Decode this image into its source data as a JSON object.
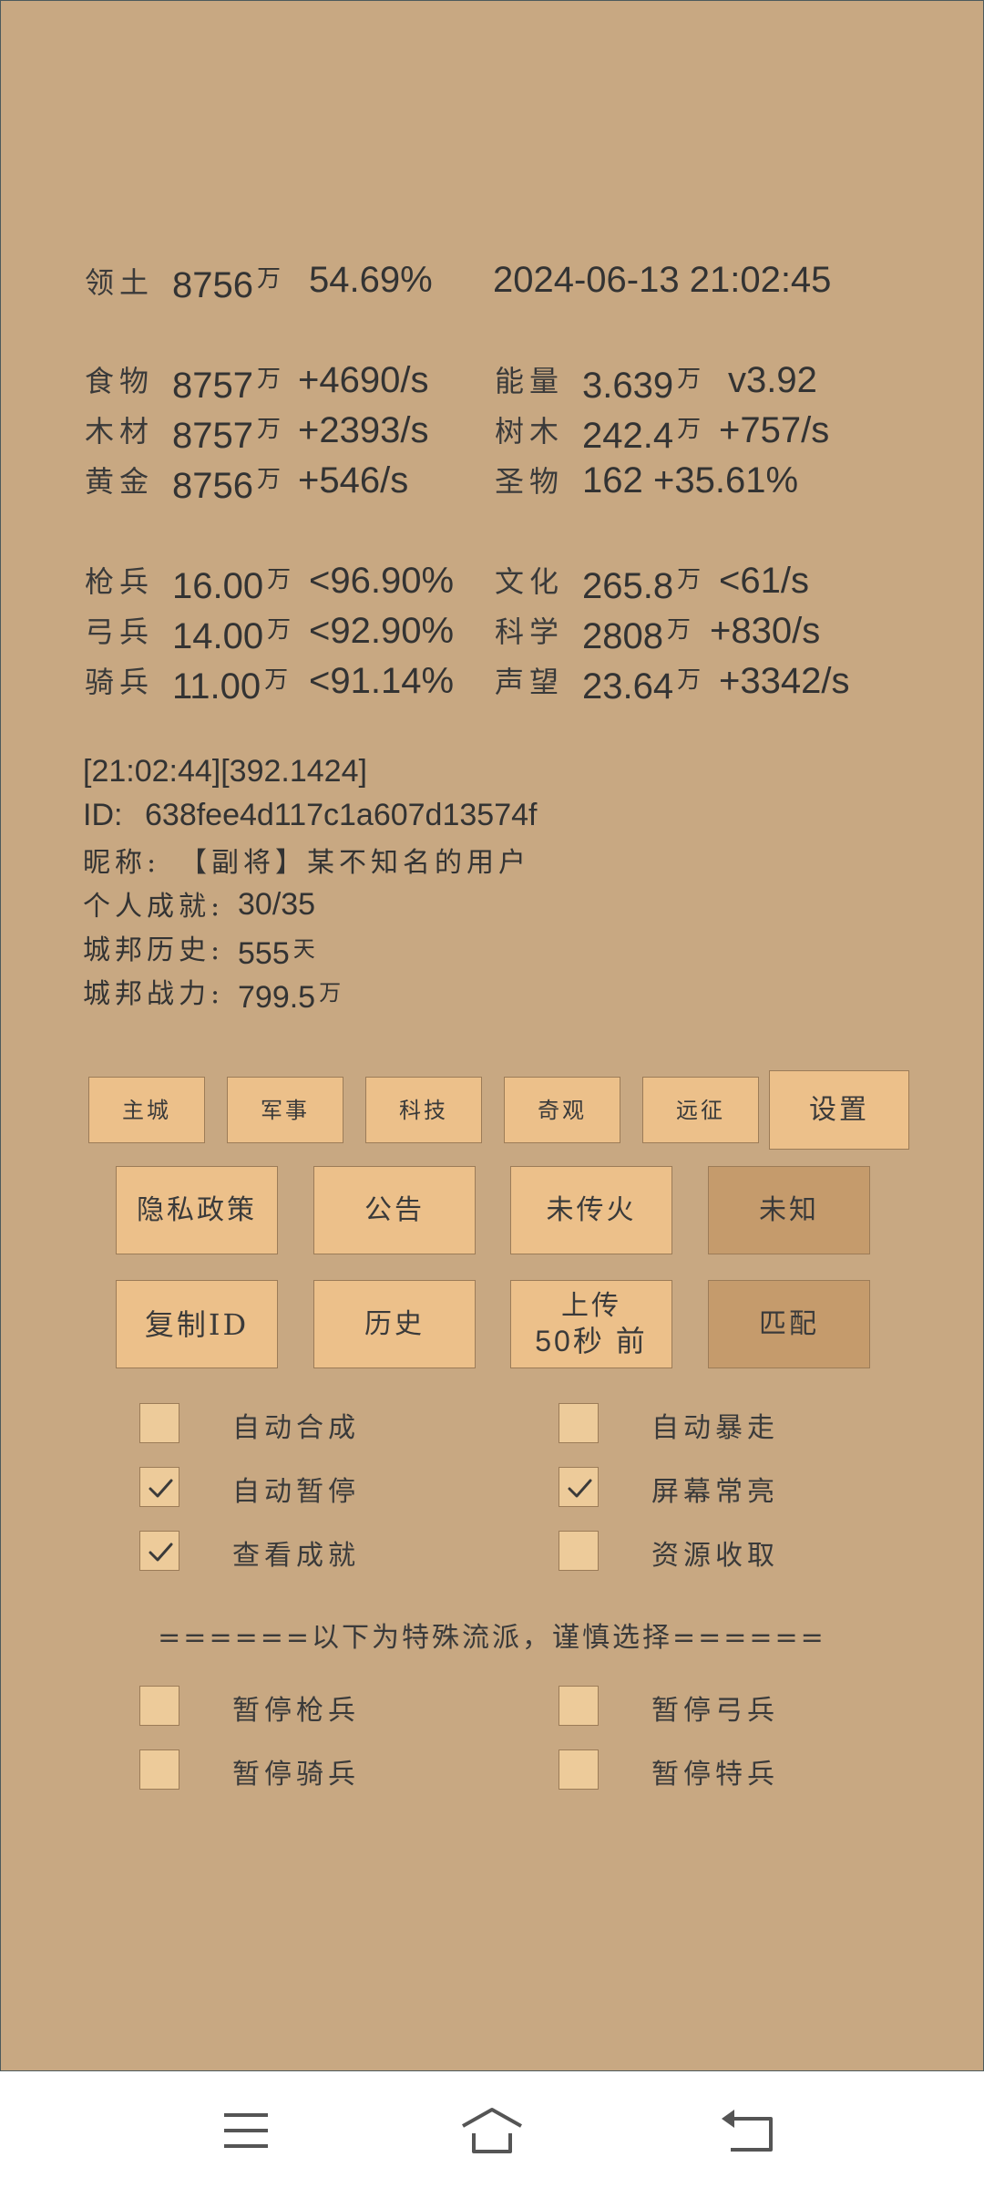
{
  "header": {
    "territory_label": "领土",
    "territory_value": "8756",
    "territory_unit": "万",
    "territory_pct": "54.69%",
    "datetime": "2024-06-13 21:02:45"
  },
  "resources": {
    "food_label": "食物",
    "food_value": "8757",
    "food_unit": "万",
    "food_rate": "+4690/s",
    "wood_label": "木材",
    "wood_value": "8757",
    "wood_unit": "万",
    "wood_rate": "+2393/s",
    "gold_label": "黄金",
    "gold_value": "8756",
    "gold_unit": "万",
    "gold_rate": "+546/s",
    "energy_label": "能量",
    "energy_value": "3.639",
    "energy_unit": "万",
    "energy_extra": "v3.92",
    "tree_label": "树木",
    "tree_value": "242.4",
    "tree_unit": "万",
    "tree_rate": "+757/s",
    "relic_label": "圣物",
    "relic_value": "162",
    "relic_rate": "+35.61%"
  },
  "troops": {
    "spear_label": "枪兵",
    "spear_value": "16.00",
    "spear_unit": "万",
    "spear_rate": "<96.90%",
    "archer_label": "弓兵",
    "archer_value": "14.00",
    "archer_unit": "万",
    "archer_rate": "<92.90%",
    "cavalry_label": "骑兵",
    "cavalry_value": "11.00",
    "cavalry_unit": "万",
    "cavalry_rate": "<91.14%",
    "culture_label": "文化",
    "culture_value": "265.8",
    "culture_unit": "万",
    "culture_rate": "<61/s",
    "science_label": "科学",
    "science_value": "2808",
    "science_unit": "万",
    "science_rate": "+830/s",
    "fame_label": "声望",
    "fame_value": "23.64",
    "fame_unit": "万",
    "fame_rate": "+3342/s"
  },
  "info": {
    "log": "[21:02:44][392.1424]",
    "id_label": "ID:",
    "id_value": "638fee4d117c1a607d13574f",
    "nick_label": "昵称:",
    "nick_value": "【副将】某不知名的用户",
    "achieve_label": "个人成就:",
    "achieve_value": "30/35",
    "history_label": "城邦历史:",
    "history_value": "555",
    "history_unit": "天",
    "power_label": "城邦战力:",
    "power_value": "799.5",
    "power_unit": "万"
  },
  "tabs": {
    "main_city": "主城",
    "military": "军事",
    "tech": "科技",
    "wonder": "奇观",
    "expedition": "远征",
    "settings": "设置"
  },
  "actions": {
    "privacy": "隐私政策",
    "notice": "公告",
    "unpass": "未传火",
    "unknown": "未知",
    "copy_id": "复制ID",
    "history": "历史",
    "upload_line1": "上传",
    "upload_line2": "50秒 前",
    "match": "匹配"
  },
  "options": {
    "auto_compose": {
      "label": "自动合成",
      "checked": false
    },
    "auto_rampage": {
      "label": "自动暴走",
      "checked": false
    },
    "auto_pause": {
      "label": "自动暂停",
      "checked": true
    },
    "screen_on": {
      "label": "屏幕常亮",
      "checked": true
    },
    "view_achieve": {
      "label": "查看成就",
      "checked": true
    },
    "resource_collect": {
      "label": "资源收取",
      "checked": false
    }
  },
  "special": {
    "divider": "======以下为特殊流派，谨慎选择======",
    "pause_spear": {
      "label": "暂停枪兵",
      "checked": false
    },
    "pause_archer": {
      "label": "暂停弓兵",
      "checked": false
    },
    "pause_cavalry": {
      "label": "暂停骑兵",
      "checked": false
    },
    "pause_special": {
      "label": "暂停特兵",
      "checked": false
    }
  },
  "navbar": {
    "icons": [
      "menu-icon",
      "home-icon",
      "back-icon"
    ]
  },
  "colors": {
    "panel": "#c8a882",
    "button": "#ecc08a",
    "button_dark": "#c59b6c",
    "checkbox": "#edcb9a"
  }
}
